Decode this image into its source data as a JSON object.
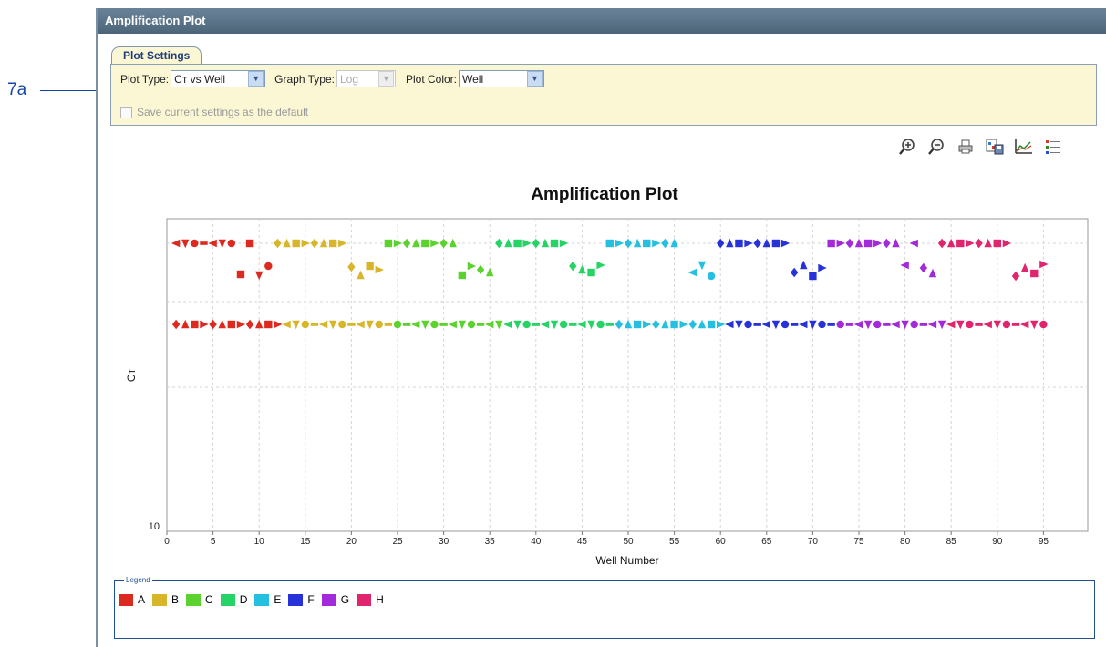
{
  "callout": "7a",
  "window": {
    "title": "Amplification Plot"
  },
  "settings": {
    "tab_label": "Plot Settings",
    "plot_type_label": "Plot Type:",
    "plot_type_value": "Cт vs Well",
    "graph_type_label": "Graph Type:",
    "graph_type_value": "Log",
    "plot_color_label": "Plot Color:",
    "plot_color_value": "Well",
    "save_default_label": "Save current settings as the default"
  },
  "toolbar": {
    "icons": [
      "zoom-in-icon",
      "zoom-out-icon",
      "print-icon",
      "save-image-icon",
      "plot-properties-icon",
      "legend-toggle-icon"
    ]
  },
  "chart_data": {
    "type": "scatter",
    "title": "Amplification Plot",
    "xlabel": "Well Number",
    "ylabel": "Cт",
    "xlim": [
      0,
      96
    ],
    "x_ticks": [
      0,
      5,
      10,
      15,
      20,
      25,
      30,
      35,
      40,
      45,
      50,
      55,
      60,
      65,
      70,
      75,
      80,
      85,
      90,
      95
    ],
    "y_ticks": [
      10
    ],
    "grid": true,
    "legend_title": "Legend",
    "legend_placement": "bottom",
    "series": [
      {
        "name": "A",
        "color": "#dd2a20",
        "points": [
          [
            1,
            1
          ],
          [
            2,
            1
          ],
          [
            3,
            1
          ],
          [
            4,
            1
          ],
          [
            5,
            1
          ],
          [
            6,
            1
          ],
          [
            7,
            1
          ],
          [
            9,
            1
          ],
          [
            8,
            2
          ],
          [
            10,
            2
          ],
          [
            11,
            2
          ],
          [
            1,
            4
          ],
          [
            2,
            4
          ],
          [
            3,
            4
          ],
          [
            4,
            4
          ],
          [
            5,
            4
          ],
          [
            6,
            4
          ],
          [
            7,
            4
          ],
          [
            8,
            4
          ],
          [
            9,
            4
          ],
          [
            10,
            4
          ],
          [
            11,
            4
          ],
          [
            12,
            4
          ]
        ]
      },
      {
        "name": "B",
        "color": "#d8b62a",
        "points": [
          [
            12,
            1
          ],
          [
            13,
            1
          ],
          [
            14,
            1
          ],
          [
            15,
            1
          ],
          [
            16,
            1
          ],
          [
            17,
            1
          ],
          [
            18,
            1
          ],
          [
            19,
            1
          ],
          [
            20,
            2
          ],
          [
            21,
            2
          ],
          [
            22,
            2
          ],
          [
            23,
            2
          ],
          [
            13,
            4
          ],
          [
            14,
            4
          ],
          [
            15,
            4
          ],
          [
            16,
            4
          ],
          [
            17,
            4
          ],
          [
            18,
            4
          ],
          [
            19,
            4
          ],
          [
            20,
            4
          ],
          [
            21,
            4
          ],
          [
            22,
            4
          ],
          [
            23,
            4
          ],
          [
            24,
            4
          ]
        ]
      },
      {
        "name": "C",
        "color": "#5bd22d",
        "points": [
          [
            24,
            1
          ],
          [
            25,
            1
          ],
          [
            26,
            1
          ],
          [
            27,
            1
          ],
          [
            28,
            1
          ],
          [
            29,
            1
          ],
          [
            30,
            1
          ],
          [
            31,
            1
          ],
          [
            32,
            2
          ],
          [
            33,
            2
          ],
          [
            34,
            2
          ],
          [
            35,
            2
          ],
          [
            25,
            4
          ],
          [
            26,
            4
          ],
          [
            27,
            4
          ],
          [
            28,
            4
          ],
          [
            29,
            4
          ],
          [
            30,
            4
          ],
          [
            31,
            4
          ],
          [
            32,
            4
          ],
          [
            33,
            4
          ],
          [
            34,
            4
          ],
          [
            35,
            4
          ],
          [
            36,
            4
          ]
        ]
      },
      {
        "name": "D",
        "color": "#26d466",
        "points": [
          [
            36,
            1
          ],
          [
            37,
            1
          ],
          [
            38,
            1
          ],
          [
            39,
            1
          ],
          [
            40,
            1
          ],
          [
            41,
            1
          ],
          [
            42,
            1
          ],
          [
            43,
            1
          ],
          [
            44,
            2
          ],
          [
            45,
            2
          ],
          [
            46,
            2
          ],
          [
            47,
            2
          ],
          [
            37,
            4
          ],
          [
            38,
            4
          ],
          [
            39,
            4
          ],
          [
            40,
            4
          ],
          [
            41,
            4
          ],
          [
            42,
            4
          ],
          [
            43,
            4
          ],
          [
            44,
            4
          ],
          [
            45,
            4
          ],
          [
            46,
            4
          ],
          [
            47,
            4
          ],
          [
            48,
            4
          ]
        ]
      },
      {
        "name": "E",
        "color": "#25bfe0",
        "points": [
          [
            48,
            1
          ],
          [
            49,
            1
          ],
          [
            50,
            1
          ],
          [
            51,
            1
          ],
          [
            52,
            1
          ],
          [
            53,
            1
          ],
          [
            54,
            1
          ],
          [
            55,
            1
          ],
          [
            57,
            2
          ],
          [
            58,
            2
          ],
          [
            59,
            2
          ],
          [
            49,
            4
          ],
          [
            50,
            4
          ],
          [
            51,
            4
          ],
          [
            52,
            4
          ],
          [
            53,
            4
          ],
          [
            54,
            4
          ],
          [
            55,
            4
          ],
          [
            56,
            4
          ],
          [
            57,
            4
          ],
          [
            58,
            4
          ],
          [
            59,
            4
          ],
          [
            60,
            4
          ]
        ]
      },
      {
        "name": "F",
        "color": "#2732d8",
        "points": [
          [
            60,
            1
          ],
          [
            61,
            1
          ],
          [
            62,
            1
          ],
          [
            63,
            1
          ],
          [
            64,
            1
          ],
          [
            65,
            1
          ],
          [
            66,
            1
          ],
          [
            67,
            1
          ],
          [
            68,
            2
          ],
          [
            69,
            2
          ],
          [
            70,
            2
          ],
          [
            71,
            2
          ],
          [
            61,
            4
          ],
          [
            62,
            4
          ],
          [
            63,
            4
          ],
          [
            64,
            4
          ],
          [
            65,
            4
          ],
          [
            66,
            4
          ],
          [
            67,
            4
          ],
          [
            68,
            4
          ],
          [
            69,
            4
          ],
          [
            70,
            4
          ],
          [
            71,
            4
          ],
          [
            72,
            4
          ]
        ]
      },
      {
        "name": "G",
        "color": "#a32ad8",
        "points": [
          [
            72,
            1
          ],
          [
            73,
            1
          ],
          [
            74,
            1
          ],
          [
            75,
            1
          ],
          [
            76,
            1
          ],
          [
            77,
            1
          ],
          [
            78,
            1
          ],
          [
            79,
            1
          ],
          [
            81,
            1
          ],
          [
            80,
            2
          ],
          [
            82,
            2
          ],
          [
            83,
            2
          ],
          [
            73,
            4
          ],
          [
            74,
            4
          ],
          [
            75,
            4
          ],
          [
            76,
            4
          ],
          [
            77,
            4
          ],
          [
            78,
            4
          ],
          [
            79,
            4
          ],
          [
            80,
            4
          ],
          [
            81,
            4
          ],
          [
            82,
            4
          ],
          [
            83,
            4
          ],
          [
            84,
            4
          ]
        ]
      },
      {
        "name": "H",
        "color": "#e0246e",
        "points": [
          [
            84,
            1
          ],
          [
            85,
            1
          ],
          [
            86,
            1
          ],
          [
            87,
            1
          ],
          [
            88,
            1
          ],
          [
            89,
            1
          ],
          [
            90,
            1
          ],
          [
            91,
            1
          ],
          [
            92,
            2
          ],
          [
            93,
            2
          ],
          [
            94,
            2
          ],
          [
            95,
            2
          ],
          [
            85,
            4
          ],
          [
            86,
            4
          ],
          [
            87,
            4
          ],
          [
            88,
            4
          ],
          [
            89,
            4
          ],
          [
            90,
            4
          ],
          [
            91,
            4
          ],
          [
            92,
            4
          ],
          [
            93,
            4
          ],
          [
            94,
            4
          ],
          [
            95,
            4
          ]
        ]
      }
    ]
  }
}
